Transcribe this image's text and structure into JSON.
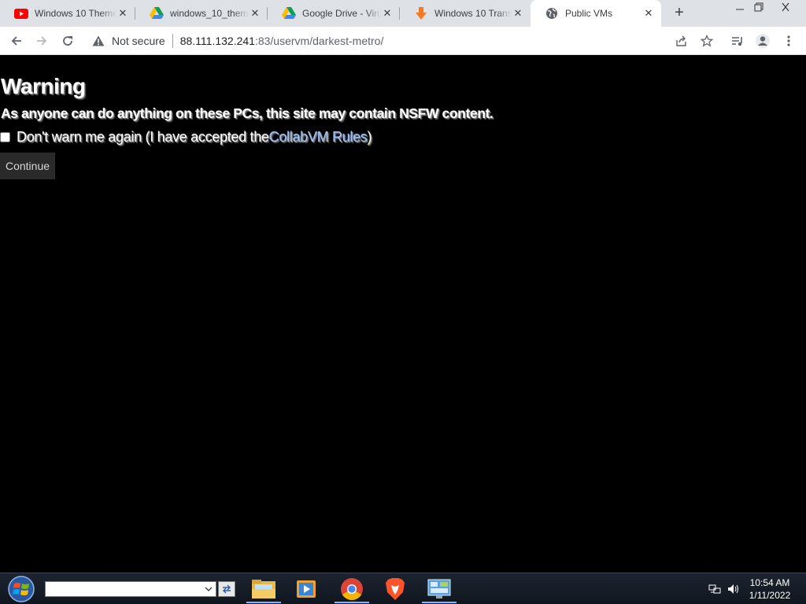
{
  "browser": {
    "tabs": [
      {
        "title": "Windows 10 Theme",
        "favicon": "youtube-icon",
        "active": false
      },
      {
        "title": "windows_10_theme",
        "favicon": "google-drive-icon",
        "active": false
      },
      {
        "title": "Google Drive - Virus",
        "favicon": "google-drive-icon",
        "active": false
      },
      {
        "title": "Windows 10 Transform",
        "favicon": "download-arrow-icon",
        "active": false
      },
      {
        "title": "Public VMs",
        "favicon": "globe-icon",
        "active": true
      }
    ],
    "toolbar": {
      "security_label": "Not secure",
      "url_host": "88.111.132.241",
      "url_rest": ":83/uservm/darkest-metro/"
    }
  },
  "page": {
    "title": "Warning",
    "message": "As anyone can do anything on these PCs, this site may contain NSFW content.",
    "checkbox_label_before": "Don't warn me again (I have accepted the ",
    "rules_link": "CollabVM Rules",
    "checkbox_label_after": ")",
    "checkbox_checked": false,
    "continue_label": "Continue"
  },
  "taskbar": {
    "search_value": "",
    "apps": [
      "file-explorer-icon",
      "media-player-icon",
      "chrome-icon",
      "brave-icon",
      "control-panel-icon"
    ],
    "clock_time": "10:54 AM",
    "clock_date": "1/11/2022"
  },
  "colors": {
    "page_background": "#000000",
    "link": "#9cc3ff",
    "tabstrip": "#dee1e6"
  }
}
